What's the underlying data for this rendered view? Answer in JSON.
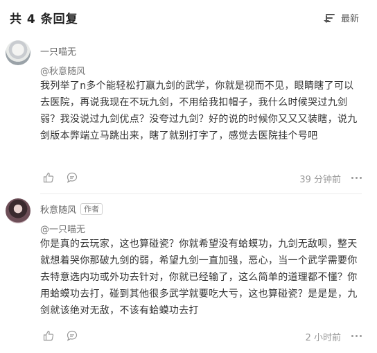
{
  "header": {
    "title": "共 4 条回复",
    "sort_label": "最新",
    "sort_icon": "sort-lines-icon"
  },
  "comments": [
    {
      "user": "一只喵无",
      "author_badge": "",
      "reply_to": "@秋意随风",
      "text": "我列举了n多个能轻松打赢九剑的武学，你就是视而不见，眼睛瞎了可以去医院，再说我现在不玩九剑，不用给我扣帽子，我什么时候哭过九剑弱？我没说过九剑优点？没夸过九剑？好的说的时候你又又又装瞎，说九剑版本弊端立马跳出来，瞎了就别打字了，感觉去医院挂个号吧",
      "time": "39 分钟前"
    },
    {
      "user": "秋意随风",
      "author_badge": "作者",
      "reply_to": "@一只喵无",
      "text": "你是真的云玩家，这也算碰瓷？你就希望没有蛤蟆功，九剑无敌呗，整天就想着哭你那破九剑的弱，希望九剑一直加强，恶心，当一个武学需要你去特意选内功或外功去针对，你就已经输了，这么简单的道理都不懂？你用蛤蟆功去打，碰到其他很多武学就要吃大亏，这也算碰瓷？是是是，九剑就该绝对无敌，不该有蛤蟆功去打",
      "time": "2 小时前"
    }
  ],
  "icons": {
    "like": "thumbs-up-icon",
    "reply": "reply-bubble-icon",
    "more": "more-dots-icon"
  }
}
